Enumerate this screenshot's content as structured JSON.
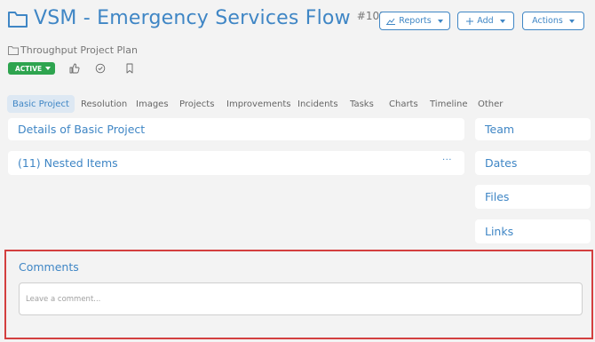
{
  "header": {
    "title": "VSM - Emergency Services Flow",
    "ticket_id": "#1028",
    "buttons": {
      "reports": "Reports",
      "add": "Add",
      "actions": "Actions"
    }
  },
  "subtitle": {
    "project_plan": "Throughput Project Plan"
  },
  "status": {
    "label": "ACTIVE"
  },
  "tabs": [
    {
      "label": "Basic Project"
    },
    {
      "label": "Resolution"
    },
    {
      "label": "Images"
    },
    {
      "label": "Projects"
    },
    {
      "label": "Improvements"
    },
    {
      "label": "Incidents"
    },
    {
      "label": "Tasks"
    },
    {
      "label": "Charts"
    },
    {
      "label": "Timeline"
    },
    {
      "label": "Other"
    }
  ],
  "main": {
    "details_title": "Details of Basic Project",
    "nested_title": "(11) Nested Items",
    "nested_menu": "···"
  },
  "side": {
    "team": "Team",
    "dates": "Dates",
    "files": "Files",
    "links": "Links"
  },
  "comments": {
    "title": "Comments",
    "placeholder": "Leave a comment..."
  },
  "colors": {
    "accent": "#3f86c5",
    "active_badge": "#2ea44f",
    "highlight_border": "#d33f3f"
  },
  "icons": [
    "folder-icon",
    "chart-icon",
    "plus-icon",
    "thumbs-up-icon",
    "check-circle-icon",
    "bookmark-icon"
  ]
}
